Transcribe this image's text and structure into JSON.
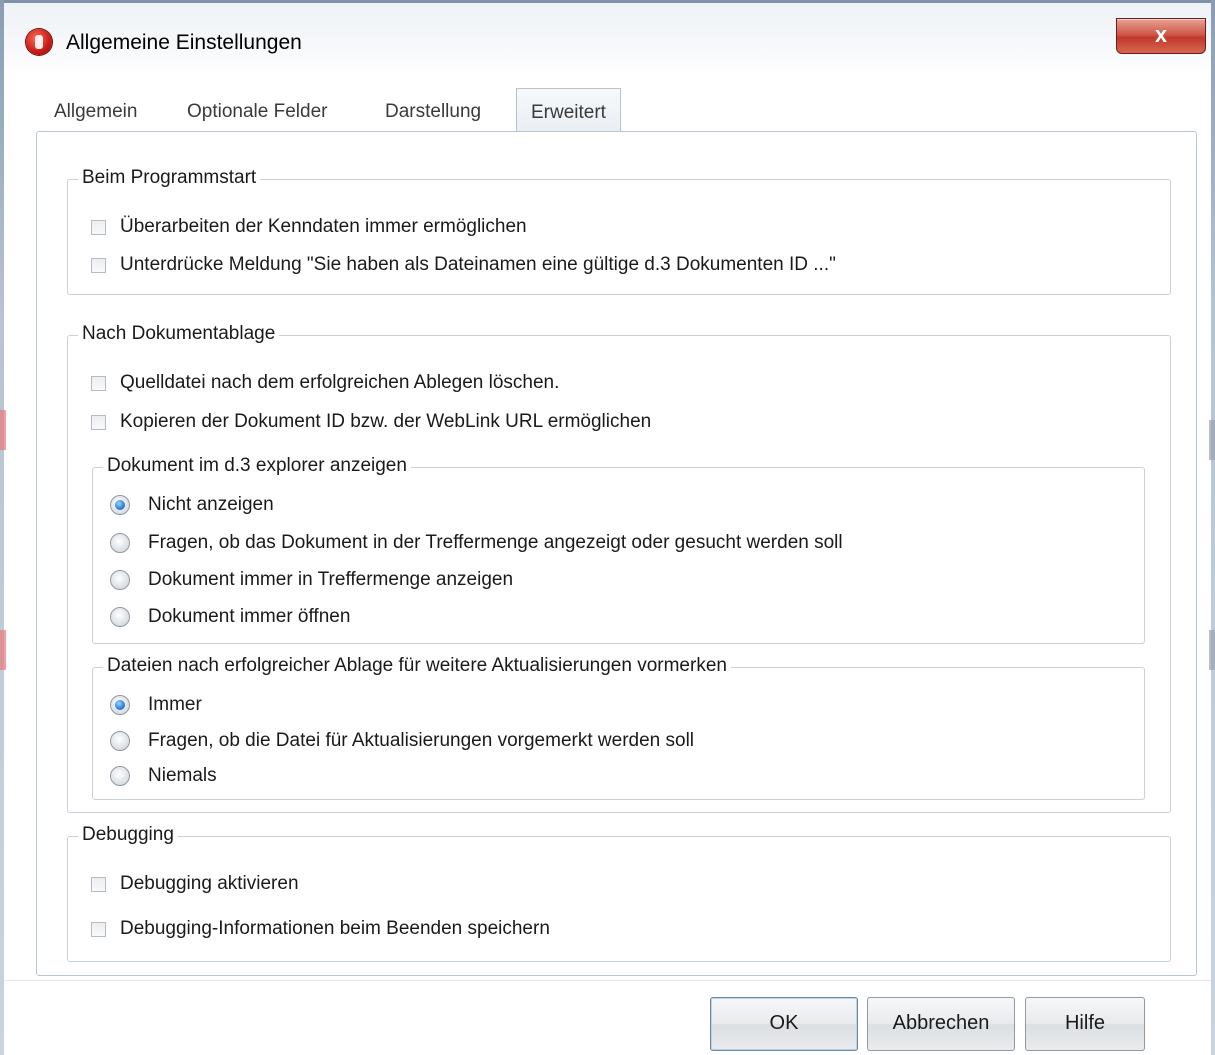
{
  "window": {
    "title": "Allgemeine Einstellungen",
    "close_label": "x"
  },
  "tabs": [
    {
      "label": "Allgemein",
      "active": false
    },
    {
      "label": "Optionale Felder",
      "active": false
    },
    {
      "label": "Darstellung",
      "active": false
    },
    {
      "label": "Erweitert",
      "active": true
    }
  ],
  "groups": {
    "startup": {
      "title": "Beim Programmstart",
      "options": [
        {
          "label": "Überarbeiten der Kenndaten immer ermöglichen",
          "checked": false
        },
        {
          "label": "Unterdrücke Meldung \"Sie haben als Dateinamen eine gültige d.3 Dokumenten ID ...\"",
          "checked": false
        }
      ]
    },
    "after_filing": {
      "title": "Nach Dokumentablage",
      "options": [
        {
          "label": "Quelldatei nach dem erfolgreichen Ablegen löschen.",
          "checked": false
        },
        {
          "label": "Kopieren der Dokument ID bzw. der WebLink URL ermöglichen",
          "checked": false
        }
      ],
      "explorer": {
        "title": "Dokument im d.3 explorer anzeigen",
        "options": [
          {
            "label": "Nicht anzeigen",
            "selected": true
          },
          {
            "label": "Fragen, ob das Dokument in der Treffermenge angezeigt oder gesucht werden soll",
            "selected": false
          },
          {
            "label": "Dokument immer in Treffermenge anzeigen",
            "selected": false
          },
          {
            "label": "Dokument immer öffnen",
            "selected": false
          }
        ]
      },
      "mark": {
        "title": "Dateien nach erfolgreicher Ablage für weitere Aktualisierungen vormerken",
        "options": [
          {
            "label": "Immer",
            "selected": true
          },
          {
            "label": "Fragen, ob die Datei für Aktualisierungen vorgemerkt werden soll",
            "selected": false
          },
          {
            "label": "Niemals",
            "selected": false
          }
        ]
      }
    },
    "debugging": {
      "title": "Debugging",
      "options": [
        {
          "label": "Debugging aktivieren",
          "checked": false
        },
        {
          "label": "Debugging-Informationen beim Beenden speichern",
          "checked": false
        }
      ]
    }
  },
  "buttons": {
    "ok": "OK",
    "cancel": "Abbrechen",
    "help": "Hilfe"
  },
  "colors": {
    "close_red": "#c0392b",
    "radio_blue": "#2a7fd6",
    "panel_border": "#b9c6d2"
  }
}
